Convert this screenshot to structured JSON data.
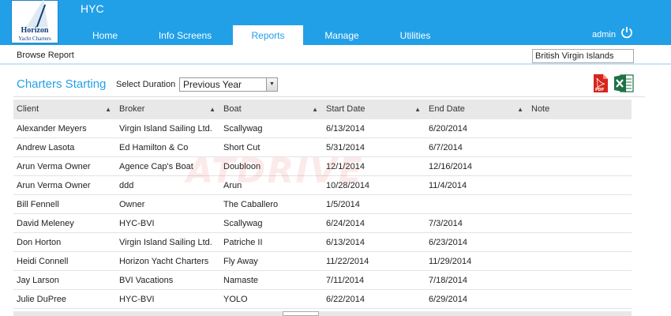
{
  "logo": {
    "brand": "Horizon",
    "brand_sub": "Yacht Charters"
  },
  "app": {
    "title": "HYC"
  },
  "nav": {
    "tabs": [
      {
        "label": "Home"
      },
      {
        "label": "Info Screens"
      },
      {
        "label": "Reports",
        "active": true
      },
      {
        "label": "Manage"
      },
      {
        "label": "Utilities"
      }
    ]
  },
  "user": {
    "name": "admin",
    "icon": "power-icon"
  },
  "breadcrumb": "Browse Report",
  "region": "British Virgin Islands",
  "report": {
    "title": "Charters Starting",
    "duration_label": "Select Duration",
    "duration_value": "Previous Year",
    "export_icons": [
      "pdf-icon",
      "excel-icon"
    ]
  },
  "table": {
    "columns": [
      "Client",
      "Broker",
      "Boat",
      "Start Date",
      "End Date",
      "Note"
    ],
    "rows": [
      [
        "Alexander Meyers",
        "Virgin Island Sailing Ltd.",
        "Scallywag",
        "6/13/2014",
        "6/20/2014",
        ""
      ],
      [
        "Andrew Lasota",
        "Ed Hamilton & Co",
        "Short Cut",
        "5/31/2014",
        "6/7/2014",
        ""
      ],
      [
        "Arun Verma Owner",
        "Agence Cap's Boat",
        "Doubloon",
        "12/1/2014",
        "12/16/2014",
        ""
      ],
      [
        "Arun Verma Owner",
        "ddd",
        "Arun",
        "10/28/2014",
        "11/4/2014",
        ""
      ],
      [
        "Bill Fennell",
        "Owner",
        "The Caballero",
        "1/5/2014",
        "",
        ""
      ],
      [
        "David Meleney",
        "HYC-BVI",
        "Scallywag",
        "6/24/2014",
        "7/3/2014",
        ""
      ],
      [
        "Don Horton",
        "Virgin Island Sailing Ltd.",
        "Patriche II",
        "6/13/2014",
        "6/23/2014",
        ""
      ],
      [
        "Heidi Connell",
        "Horizon Yacht Charters",
        "Fly Away",
        "11/22/2014",
        "11/29/2014",
        ""
      ],
      [
        "Jay Larson",
        "BVI Vacations",
        "Namaste",
        "7/11/2014",
        "7/18/2014",
        ""
      ],
      [
        "Julie DuPree",
        "HYC-BVI",
        "YOLO",
        "6/22/2014",
        "6/29/2014",
        ""
      ]
    ]
  },
  "watermark": "ATDRIVE",
  "colors": {
    "header": "#21a0e8",
    "accent": "#21a0e8",
    "table_header": "#e8e8e8"
  }
}
